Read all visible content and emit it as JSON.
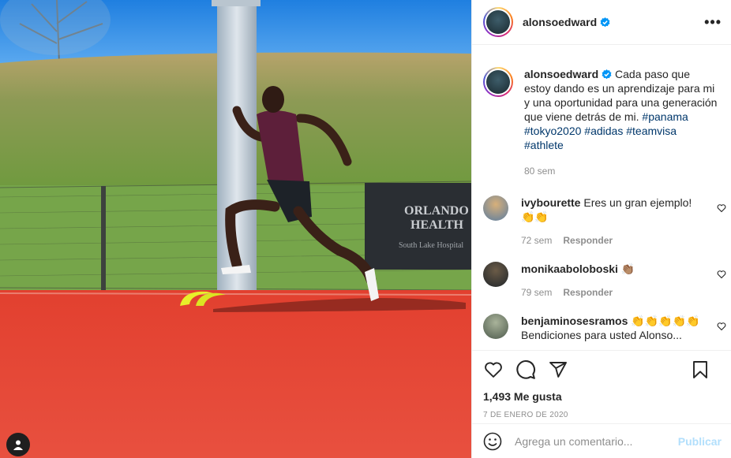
{
  "post": {
    "username": "alonsoedward",
    "caption_text": "Cada paso que estoy dando es un aprendizaje para mi y una oportunidad para una generación que viene detrás de mi.",
    "hashtags": [
      "#panama",
      "#tokyo2020",
      "#adidas",
      "#teamvisa",
      "#athlete"
    ],
    "caption_time": "80 sem",
    "photo_signage": [
      "ORLANDO",
      "HEALTH",
      "South Lake Hospital"
    ]
  },
  "comments": [
    {
      "username": "ivybourette",
      "text": "Eres un gran ejemplo!",
      "emoji": "👏👏",
      "time": "72 sem",
      "reply": "Responder"
    },
    {
      "username": "monikaaboloboski",
      "text": "",
      "emoji": "👏🏽",
      "time": "79 sem",
      "reply": "Responder"
    },
    {
      "username": "benjaminosesramos",
      "text": "Bendiciones para usted Alonso...",
      "emoji": "👏👏👏👏👏",
      "time": "",
      "reply": ""
    }
  ],
  "engagement": {
    "likes": "1,493 Me gusta",
    "date": "7 DE ENERO DE 2020"
  },
  "composer": {
    "placeholder": "Agrega un comentario...",
    "post_label": "Publicar"
  },
  "icons": [
    "more-icon",
    "verified-icon",
    "heart-icon",
    "comment-icon",
    "share-icon",
    "bookmark-icon",
    "emoji-icon",
    "user-tag-icon"
  ],
  "colors": {
    "link": "#00376b",
    "verified": "#0095f6",
    "post_disabled": "#b2dffc",
    "meta": "#8e8e8e"
  }
}
